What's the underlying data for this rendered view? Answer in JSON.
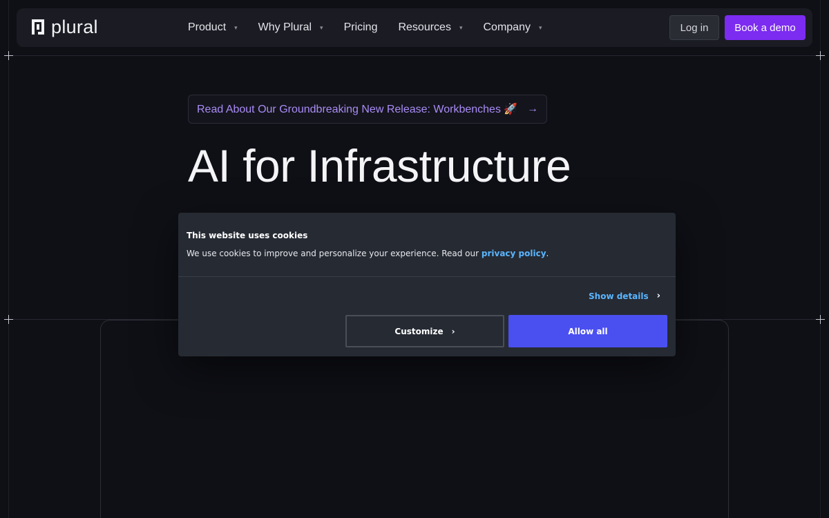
{
  "brand": {
    "name": "plural"
  },
  "nav": {
    "items": [
      {
        "label": "Product",
        "has_dropdown": true
      },
      {
        "label": "Why Plural",
        "has_dropdown": true
      },
      {
        "label": "Pricing",
        "has_dropdown": false
      },
      {
        "label": "Resources",
        "has_dropdown": true
      },
      {
        "label": "Company",
        "has_dropdown": true
      }
    ],
    "caret_glyph": "▾",
    "login_label": "Log in",
    "demo_label": "Book a demo"
  },
  "hero": {
    "announcement": "Read About Our Groundbreaking New Release: Workbenches 🚀",
    "announcement_arrow": "→",
    "title": "AI for Infrastructure"
  },
  "cookie": {
    "title": "This website uses cookies",
    "text_before": "We use cookies to improve and personalize your experience. Read our ",
    "link": "privacy policy",
    "text_after": ".",
    "show_details": "Show details",
    "customize": "Customize",
    "allow_all": "Allow all",
    "chevron_glyph": "›"
  },
  "colors": {
    "background": "#0f1016",
    "accent": "#7c2bf1",
    "announcement_text": "#a98cf6",
    "cookie_link": "#5ab6ff",
    "allow_all": "#4a4ff0"
  }
}
